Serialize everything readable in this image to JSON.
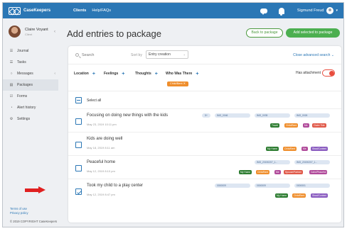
{
  "app": {
    "logo_text": "CaseKeepers",
    "nav": [
      "Clients",
      "Help/FAQs"
    ],
    "user_name": "Sigmund Freud"
  },
  "sidebar": {
    "profile_name": "Claire Voyant",
    "profile_role": "Client",
    "items": [
      {
        "label": "Journal",
        "icon": "list-icon"
      },
      {
        "label": "Tasks",
        "icon": "tasks-icon"
      },
      {
        "label": "Messages",
        "icon": "chat-icon"
      },
      {
        "label": "Packages",
        "icon": "package-icon"
      },
      {
        "label": "Forms",
        "icon": "form-icon"
      },
      {
        "label": "Alert history",
        "icon": "alert-icon"
      },
      {
        "label": "Settings",
        "icon": "gear-icon"
      }
    ],
    "footer": {
      "terms": "Terms of use",
      "privacy": "Privacy policy",
      "copyright": "© 2019 COPYRIGHT CaseKeepers"
    }
  },
  "page": {
    "title": "Add entries to package",
    "back_button": "Back to package",
    "add_button": "Add selected to package"
  },
  "search": {
    "placeholder": "Search",
    "sort_label": "Sort by",
    "sort_value": "Entry creation",
    "advanced_link": "Close advanced search"
  },
  "filters": {
    "location": "Location",
    "feelings": "Feelings",
    "thoughts": "Thoughts",
    "who": "Who Was There",
    "who_chip": "Child/Bent",
    "has_attachment": "Has attachment"
  },
  "select_all": "Select all",
  "entries": [
    {
      "title": "Focusing on doing new things with the kids",
      "date": "May 23, 2019 10:11 pm",
      "files": [
        "5+",
        "IMG_0046",
        "IMG_0035",
        "IMG_0026"
      ],
      "tags": [
        "Travel",
        "Child/Bent",
        "Me",
        "Claire Tide"
      ],
      "tag_colors": [
        "#2e7d32",
        "#ef8e2c",
        "#b04a9a",
        "#e05a4a"
      ]
    },
    {
      "title": "Kids are doing well",
      "date": "May 18, 2019 8:11 am",
      "files": [],
      "tags": [
        "My Home",
        "Child/Bent",
        "Me",
        "Sbad/Content"
      ],
      "tag_colors": [
        "#2e7d32",
        "#ef8e2c",
        "#b04a9a",
        "#8a5cc0"
      ]
    },
    {
      "title": "Peaceful home",
      "date": "May 12, 2019 8:10 pm",
      "files": [
        "IMG_20190207_1...",
        "IMG_20190207_1..."
      ],
      "tags": [
        "My Home",
        "Child/Bent",
        "Me",
        "Spouse/Partner",
        "Calm/Peaceful"
      ],
      "tag_colors": [
        "#2e7d32",
        "#ef8e2c",
        "#b04a9a",
        "#e05a4a",
        "#b04a9a"
      ]
    },
    {
      "title": "Took my child to a play center",
      "date": "May 12, 2019 8:47 pm",
      "files": [
        "0000009",
        "0000009",
        "0000001"
      ],
      "tags": [
        "My Home",
        "Child/Bent",
        "Sbad/Content"
      ],
      "tag_colors": [
        "#2e7d32",
        "#ef8e2c",
        "#8a5cc0"
      ]
    }
  ]
}
